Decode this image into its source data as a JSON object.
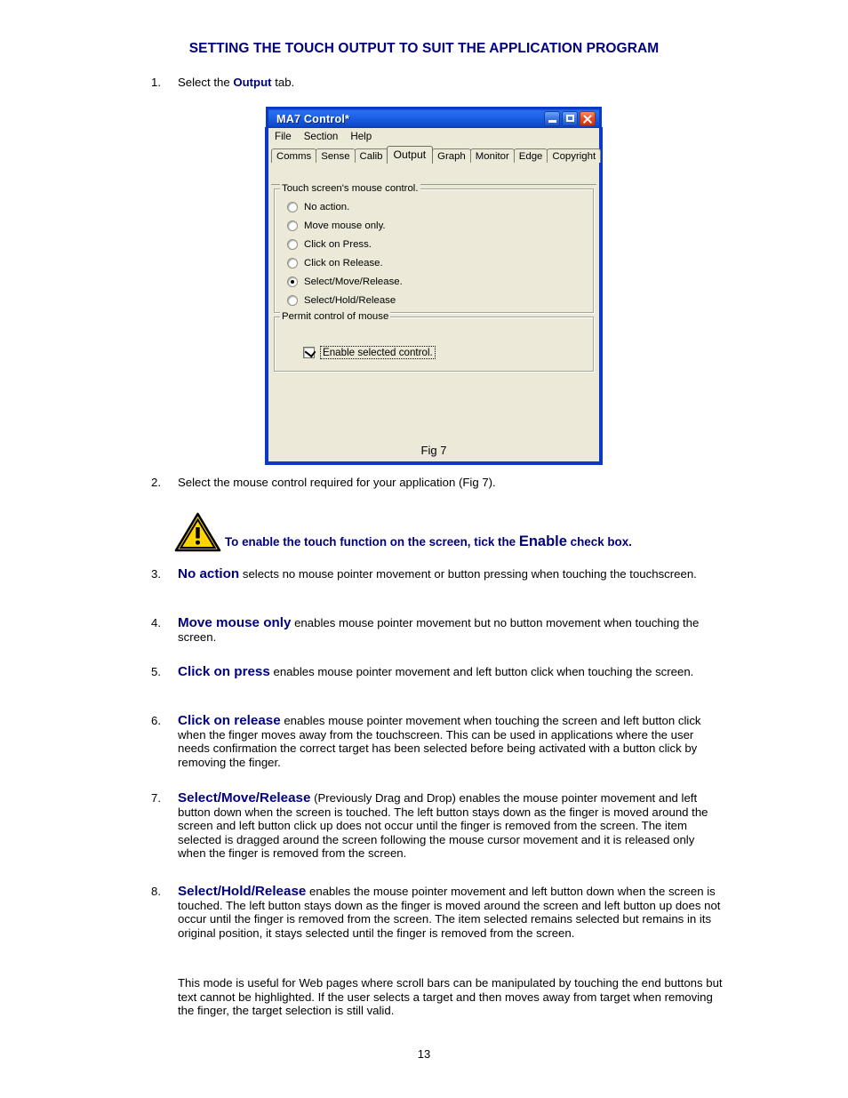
{
  "document": {
    "title": "SETTING THE TOUCH OUTPUT TO SUIT THE APPLICATION PROGRAM",
    "page_number": "13",
    "figure_caption": "Fig 7"
  },
  "steps": {
    "step1": {
      "num": "1.",
      "pre": "Select the ",
      "keyword": "Output",
      "post": " tab."
    },
    "step2": {
      "num": "2.",
      "text": "Select the mouse control required for your application (Fig 7)."
    },
    "step3": {
      "num": "3.",
      "keyword": "No action",
      "text": " selects no mouse pointer movement or button pressing when touching the touchscreen."
    },
    "step4": {
      "num": "4.",
      "keyword": "Move mouse only",
      "text": " enables mouse pointer movement but no button movement when touching the screen."
    },
    "step5": {
      "num": "5.",
      "keyword": "Click on press",
      "text": " enables mouse pointer movement and left button click when touching the screen."
    },
    "step6": {
      "num": "6.",
      "keyword": "Click on release",
      "text": " enables mouse pointer movement when touching the screen and left button click when the finger moves away from the touchscreen. This can be used in applications where the user needs confirmation the correct target has been selected before being activated with a button click by removing the finger."
    },
    "step7": {
      "num": "7.",
      "keyword": "Select/Move/Release",
      "text": " (Previously Drag and Drop) enables the mouse pointer movement and left button down when the screen is touched. The left button stays down as the finger is moved around the screen and left button click up does not occur until the finger is removed from the screen. The item selected is dragged around the screen following the mouse cursor movement and it is released only when the finger is removed from the screen."
    },
    "step8": {
      "num": "8.",
      "keyword": "Select/Hold/Release",
      "text": " enables the mouse pointer movement and left button down when the screen is touched. The left button stays down as the finger is moved around the screen and left button up does not occur until the finger is removed from the screen. The item selected remains selected but remains in its original position, it stays selected until the finger is removed from the screen."
    },
    "step8_note": "This mode is useful for Web pages where scroll bars can be manipulated by touching the end buttons but text cannot be highlighted. If the user selects a target and then moves away from target when removing the finger, the target selection is still valid."
  },
  "warning": {
    "icon": "warning-triangle-icon",
    "pre": "To enable the touch function on the screen, tick the ",
    "emphasis": "Enable",
    "post": " check box.",
    "icon_color": "#ffd400"
  },
  "window": {
    "title": "MA7 Control*",
    "titlebar_color": "#1e62e8",
    "body_color": "#ece9d8",
    "buttons": {
      "minimize": "minimize-button",
      "maximize": "maximize-button",
      "close": "close-button"
    },
    "menu": [
      "File",
      "Section",
      "Help"
    ],
    "tabs": [
      {
        "label": "Comms",
        "active": false
      },
      {
        "label": "Sense",
        "active": false
      },
      {
        "label": "Calib",
        "active": false
      },
      {
        "label": "Output",
        "active": true
      },
      {
        "label": "Graph",
        "active": false
      },
      {
        "label": "Monitor",
        "active": false
      },
      {
        "label": "Edge",
        "active": false
      },
      {
        "label": "Copyright",
        "active": false
      }
    ],
    "mouse_control_group": {
      "legend": "Touch screen's mouse control.",
      "options": [
        {
          "label": "No action.",
          "selected": false
        },
        {
          "label": "Move mouse only.",
          "selected": false
        },
        {
          "label": "Click on Press.",
          "selected": false
        },
        {
          "label": "Click on Release.",
          "selected": false
        },
        {
          "label": "Select/Move/Release.",
          "selected": true
        },
        {
          "label": "Select/Hold/Release",
          "selected": false
        }
      ]
    },
    "permit_group": {
      "legend": "Permit control of mouse",
      "checkbox_label": "Enable selected control.",
      "checked": true
    }
  }
}
